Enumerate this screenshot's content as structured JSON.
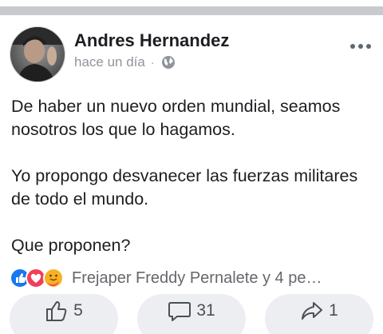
{
  "post": {
    "author_name": "Andres Hernandez",
    "timestamp": "hace un día",
    "separator": "·",
    "privacy_icon": "globe-icon",
    "more_icon": "more-options-icon",
    "paragraphs": [
      "De haber un nuevo orden mundial, seamos nosotros los que lo hagamos.",
      "Yo propongo desvanecer las fuerzas militares de todo el mundo.",
      "Que proponen?"
    ]
  },
  "reactions": {
    "icons": [
      "like-reaction-icon",
      "love-reaction-icon",
      "care-reaction-icon"
    ],
    "summary": "Frejaper Freddy Pernalete y 4 pe…",
    "colors": {
      "like": "#1877f2",
      "love": "#f33e58",
      "care": "#f7b125"
    }
  },
  "actions": {
    "like": {
      "icon": "thumbs-up-icon",
      "count": "5"
    },
    "comment": {
      "icon": "comment-icon",
      "count": "31"
    },
    "share": {
      "icon": "share-icon",
      "count": "1"
    }
  }
}
